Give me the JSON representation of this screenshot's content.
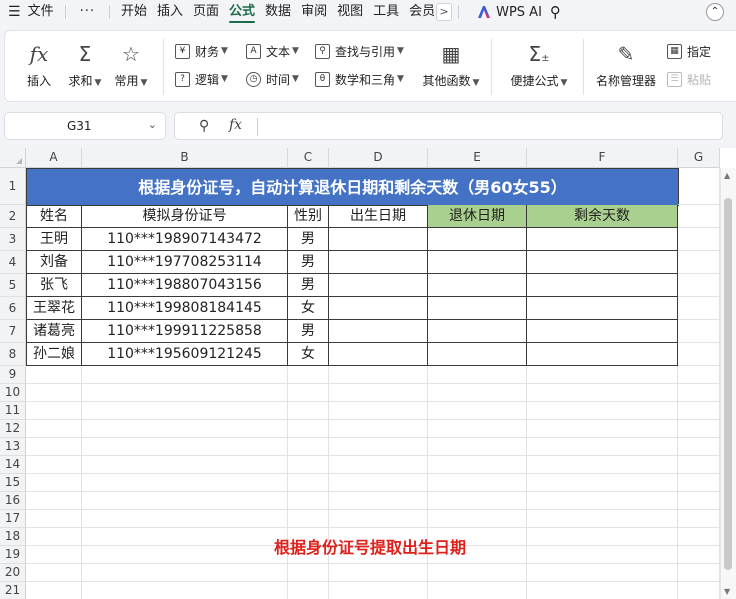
{
  "menu": {
    "hamburger": "☰",
    "file": "文件",
    "dots": "···",
    "tabs": [
      "开始",
      "插入",
      "页面",
      "公式",
      "数据",
      "审阅",
      "视图",
      "工具",
      "会员"
    ],
    "active_tab": "公式",
    "wps_ai": "WPS AI"
  },
  "ribbon": {
    "insert": "插入",
    "sum": "求和",
    "common": "常用",
    "finance": "财务",
    "text": "文本",
    "lookup": "查找与引用",
    "logic": "逻辑",
    "time": "时间",
    "math": "数学和三角",
    "other": "其他函数",
    "quick": "便捷公式",
    "name_mgr": "名称管理器",
    "specify": "指定",
    "paste": "粘贴"
  },
  "formula_bar": {
    "cell_ref": "G31",
    "fx": "fx",
    "content": ""
  },
  "columns": [
    "A",
    "B",
    "C",
    "D",
    "E",
    "F",
    "G"
  ],
  "rows": [
    "1",
    "2",
    "3",
    "4",
    "5",
    "6",
    "7",
    "8",
    "9",
    "10",
    "11",
    "12",
    "13",
    "14",
    "15",
    "16",
    "17",
    "18",
    "19",
    "20",
    "21"
  ],
  "sheet": {
    "title": "根据身份证号，自动计算退休日期和剩余天数（男60女55）",
    "headers": [
      "姓名",
      "模拟身份证号",
      "性别",
      "出生日期",
      "退休日期",
      "剩余天数"
    ],
    "data": [
      [
        "王明",
        "110***198907143472",
        "男",
        "",
        "",
        ""
      ],
      [
        "刘备",
        "110***197708253114",
        "男",
        "",
        "",
        ""
      ],
      [
        "张飞",
        "110***198807043156",
        "男",
        "",
        "",
        ""
      ],
      [
        "王翠花",
        "110***199808184145",
        "女",
        "",
        "",
        ""
      ],
      [
        "诸葛亮",
        "110***199911225858",
        "男",
        "",
        "",
        ""
      ],
      [
        "孙二娘",
        "110***195609121245",
        "女",
        "",
        "",
        ""
      ]
    ],
    "note": "根据身份证号提取出生日期"
  },
  "colors": {
    "title_bg": "#4472c4",
    "green_header": "#a9d08e",
    "note_red": "#e0201b",
    "active_tab": "#1c6b48"
  }
}
